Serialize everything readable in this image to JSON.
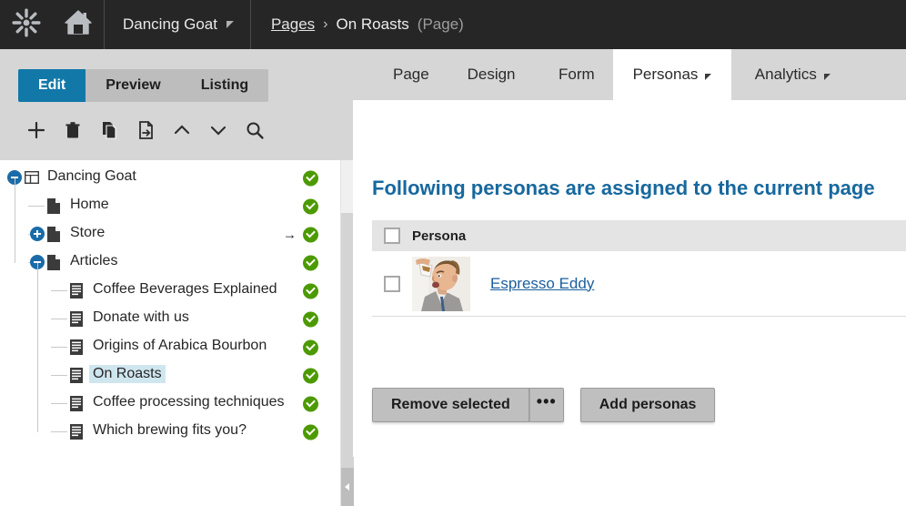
{
  "topbar": {
    "logo_icon": "kentico-asterisk-logo",
    "home_icon": "home-icon",
    "site_name": "Dancing Goat",
    "breadcrumb": {
      "root": "Pages",
      "separator": "›",
      "current": "On Roasts",
      "type": "(Page)"
    }
  },
  "left_panel": {
    "view_modes": [
      {
        "label": "Edit",
        "active": true
      },
      {
        "label": "Preview",
        "active": false
      },
      {
        "label": "Listing",
        "active": false
      }
    ],
    "toolbar": [
      {
        "name": "new-page-icon",
        "title": "New"
      },
      {
        "name": "delete-icon",
        "title": "Delete"
      },
      {
        "name": "copy-icon",
        "title": "Copy"
      },
      {
        "name": "move-icon",
        "title": "Move"
      },
      {
        "name": "move-up-icon",
        "title": "Up"
      },
      {
        "name": "move-down-icon",
        "title": "Down"
      },
      {
        "name": "search-icon",
        "title": "Search"
      }
    ],
    "tree": [
      {
        "label": "Dancing Goat",
        "level": 0,
        "icon": "site-icon",
        "toggle": "minus",
        "status": "published",
        "selected": false,
        "arrow": false
      },
      {
        "label": "Home",
        "level": 1,
        "icon": "page-icon",
        "toggle": "none",
        "status": "published",
        "selected": false,
        "arrow": false
      },
      {
        "label": "Store",
        "level": 1,
        "icon": "page-icon",
        "toggle": "plus",
        "status": "published",
        "selected": false,
        "arrow": true
      },
      {
        "label": "Articles",
        "level": 1,
        "icon": "page-icon",
        "toggle": "minus",
        "status": "published",
        "selected": false,
        "arrow": false
      },
      {
        "label": "Coffee Beverages Explained",
        "level": 2,
        "icon": "article-icon",
        "toggle": "none",
        "status": "published",
        "selected": false,
        "arrow": false
      },
      {
        "label": "Donate with us",
        "level": 2,
        "icon": "article-icon",
        "toggle": "none",
        "status": "published",
        "selected": false,
        "arrow": false
      },
      {
        "label": "Origins of Arabica Bourbon",
        "level": 2,
        "icon": "article-icon",
        "toggle": "none",
        "status": "published",
        "selected": false,
        "arrow": false
      },
      {
        "label": "On Roasts",
        "level": 2,
        "icon": "article-icon",
        "toggle": "none",
        "status": "published",
        "selected": true,
        "arrow": false
      },
      {
        "label": "Coffee processing techniques",
        "level": 2,
        "icon": "article-icon",
        "toggle": "none",
        "status": "published",
        "selected": false,
        "arrow": false
      },
      {
        "label": "Which brewing fits you?",
        "level": 2,
        "icon": "article-icon",
        "toggle": "none",
        "status": "published",
        "selected": false,
        "arrow": false
      }
    ]
  },
  "right_panel": {
    "tabs": [
      {
        "label": "Page",
        "active": false,
        "has_menu": false
      },
      {
        "label": "Design",
        "active": false,
        "has_menu": false
      },
      {
        "label": "Form",
        "active": false,
        "has_menu": false
      },
      {
        "label": "Personas",
        "active": true,
        "has_menu": true
      },
      {
        "label": "Analytics",
        "active": false,
        "has_menu": true
      }
    ],
    "heading": "Following personas are assigned to the current page",
    "table": {
      "columns": [
        "Persona"
      ],
      "rows": [
        {
          "name": "Espresso Eddy",
          "avatar": "persona-photo-espresso-eddy",
          "checked": false
        }
      ],
      "header_checked": false
    },
    "buttons": {
      "remove_selected": "Remove selected",
      "more": "•••",
      "add_personas": "Add personas"
    }
  },
  "colors": {
    "topbar_bg": "#262626",
    "panel_bg": "#d6d6d6",
    "accent_blue": "#1278a8",
    "heading_blue": "#17689e",
    "link_blue": "#1a5f9e",
    "status_green": "#4c9a00",
    "selection_highlight": "#cfe6ef"
  }
}
